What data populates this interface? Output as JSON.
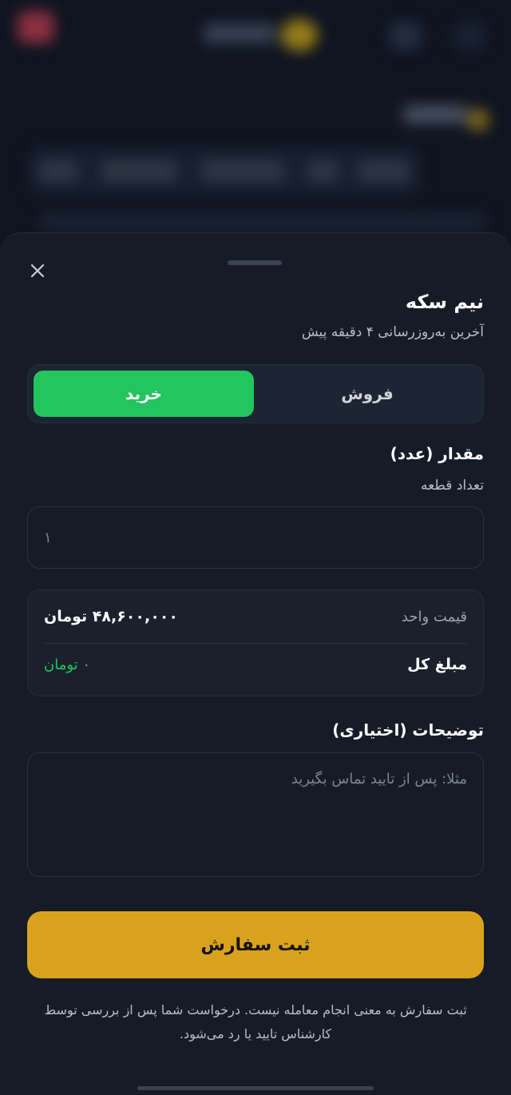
{
  "sheet": {
    "title": "نیم سکه",
    "subtitle": "آخرین به‌روزرسانی ۴ دقیقه پیش",
    "toggle": {
      "sell_label": "فروش",
      "buy_label": "خرید",
      "selected": "buy"
    },
    "quantity": {
      "label": "مقدار (عدد)",
      "hint": "تعداد قطعه",
      "placeholder": "۱"
    },
    "price": {
      "unit_label": "قیمت واحد",
      "unit_value": "۴۸,۶۰۰,۰۰۰ تومان",
      "total_label": "مبلغ کل",
      "total_value": "۰ تومان"
    },
    "notes": {
      "label": "توضیحات (اختیاری)",
      "placeholder": "مثلا: پس از تایید تماس بگیرید"
    },
    "submit_label": "ثبت سفارش",
    "footnote": "ثبت سفارش به معنی انجام معامله نیست. درخواست شما پس از بررسی توسط کارشناس تایید یا رد می‌شود."
  },
  "colors": {
    "buy_accent": "#22c55e",
    "submit_accent": "#d9a21d",
    "sheet_bg": "#161c27"
  },
  "icons": {
    "close": "close-icon"
  }
}
